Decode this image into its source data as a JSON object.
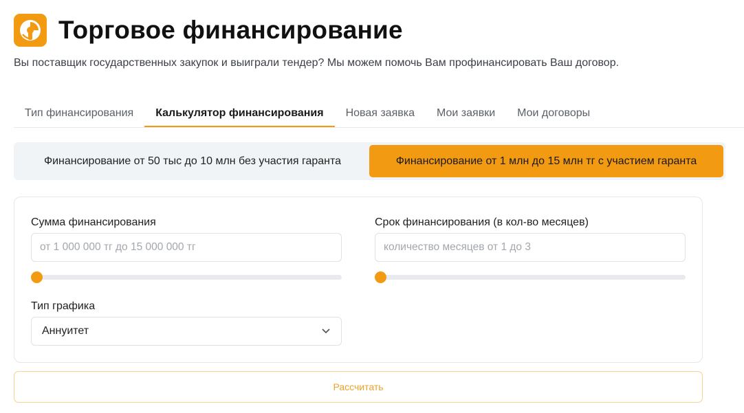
{
  "header": {
    "title": "Торговое финансирование",
    "subtitle": "Вы поставщик государственных закупок и выиграли тендер? Мы можем помочь Вам профинансировать Ваш договор.",
    "logo_icon": "coin-hand-icon",
    "accent_color": "#f29b12"
  },
  "tabs": [
    {
      "label": "Тип финансирования",
      "active": false
    },
    {
      "label": "Калькулятор финансирования",
      "active": true
    },
    {
      "label": "Новая заявка",
      "active": false
    },
    {
      "label": "Мои заявки",
      "active": false
    },
    {
      "label": "Мои договоры",
      "active": false
    }
  ],
  "segments": {
    "option1": "Финансирование от 50 тыс до 10 млн без участия гаранта",
    "option2": "Финансирование от 1 млн до 15 млн тг с участием гаранта",
    "selected": "option2"
  },
  "form": {
    "amount": {
      "label": "Сумма финансирования",
      "value": "",
      "placeholder": "от 1 000 000 тг до 15 000 000 тг",
      "slider_fraction": 0
    },
    "term": {
      "label": "Срок финансирования (в кол-во месяцев)",
      "value": "",
      "placeholder": "количество месяцев от 1 до 3",
      "slider_fraction": 0
    },
    "schedule": {
      "label": "Тип графика",
      "selected": "Аннуитет"
    }
  },
  "calculate_label": "Рассчитать"
}
